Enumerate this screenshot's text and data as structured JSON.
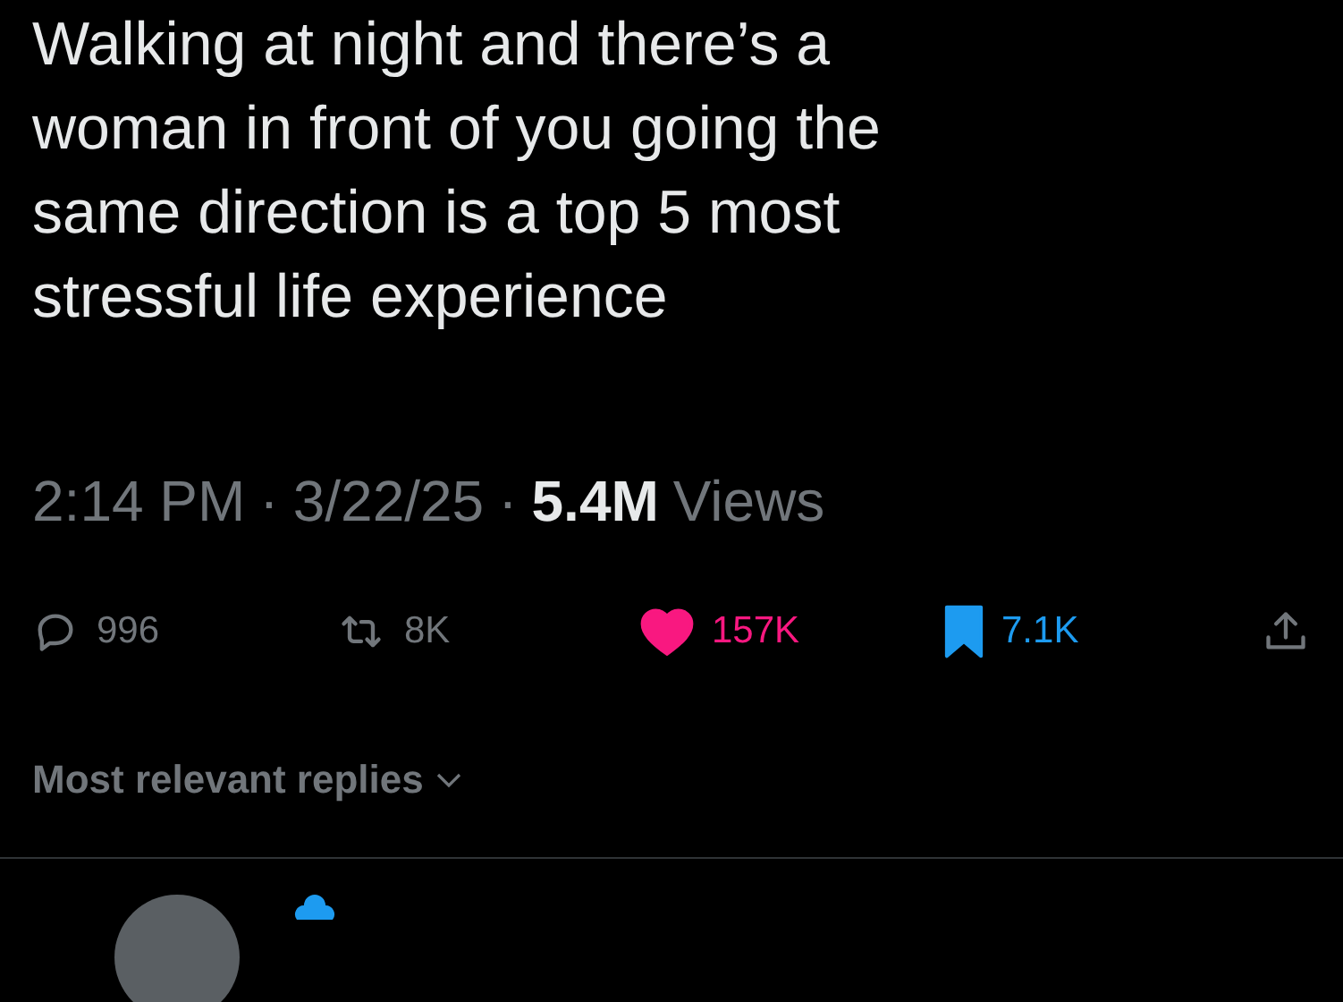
{
  "post": {
    "text_lines": [
      "Walking at night and there’s a",
      "woman in front of you going the",
      "same direction is a top 5 most",
      "stressful life experience"
    ],
    "time": "2:14 PM",
    "separators": [
      "·",
      "·"
    ],
    "date": "3/22/25",
    "views_count": "5.4M",
    "views_label": "Views"
  },
  "actions": [
    {
      "kind": "reply",
      "count": "996",
      "selected": false
    },
    {
      "kind": "repost",
      "count": "8K",
      "selected": false
    },
    {
      "kind": "like",
      "count": "157K",
      "selected": true
    },
    {
      "kind": "bookmark",
      "count": "7.1K",
      "selected": true
    },
    {
      "kind": "share",
      "selected": false
    }
  ],
  "replies_sort": {
    "label": "Most relevant replies"
  }
}
